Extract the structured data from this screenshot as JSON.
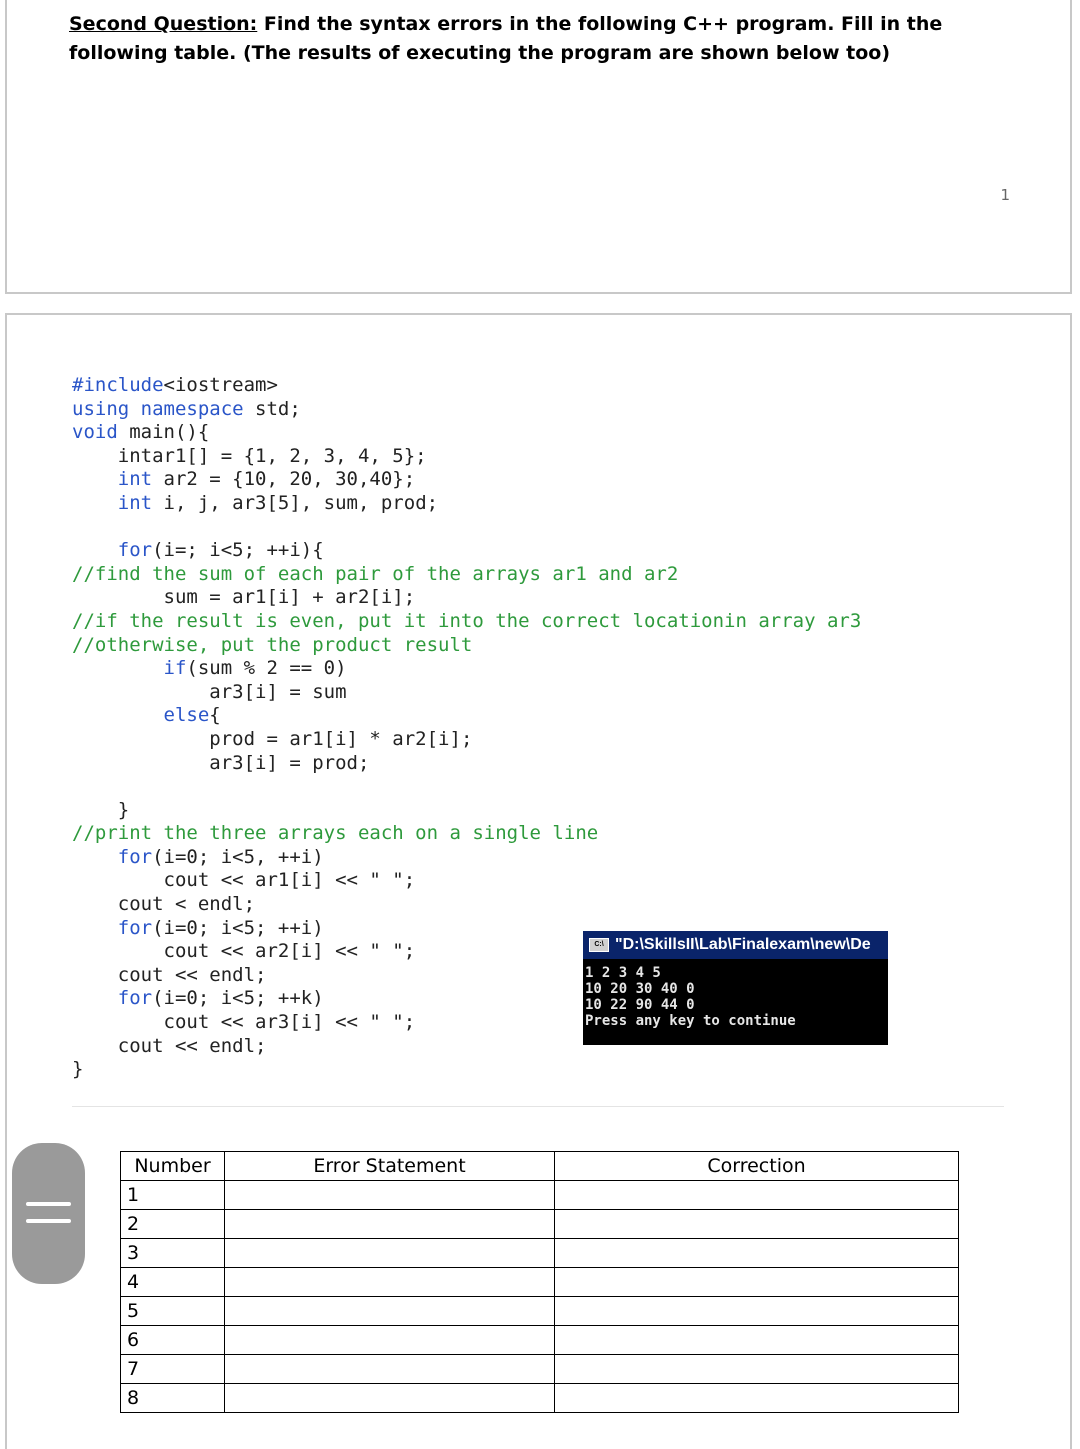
{
  "question": {
    "label": "Second Question:",
    "text": " Find the syntax errors in the following C++ program. Fill in the following table. (The results of executing the program are shown below too)"
  },
  "page_number": "1",
  "code_lines": [
    {
      "indent": "",
      "parts": [
        {
          "t": "#include",
          "c": "kw"
        },
        {
          "t": "<iostream>",
          "c": ""
        }
      ]
    },
    {
      "indent": "",
      "parts": [
        {
          "t": "using namespace",
          "c": "kw"
        },
        {
          "t": " std;",
          "c": ""
        }
      ]
    },
    {
      "indent": "",
      "parts": [
        {
          "t": "void",
          "c": "kw"
        },
        {
          "t": " main(){",
          "c": ""
        }
      ]
    },
    {
      "indent": "    ",
      "parts": [
        {
          "t": "intar1[] = {1, 2, 3, 4, 5};",
          "c": ""
        }
      ]
    },
    {
      "indent": "    ",
      "parts": [
        {
          "t": "int",
          "c": "kw"
        },
        {
          "t": " ar2 = {10, 20, 30,40};",
          "c": ""
        }
      ]
    },
    {
      "indent": "    ",
      "parts": [
        {
          "t": "int",
          "c": "kw"
        },
        {
          "t": " i, j, ar3[5], sum, prod;",
          "c": ""
        }
      ]
    },
    {
      "indent": "",
      "parts": []
    },
    {
      "indent": "    ",
      "parts": [
        {
          "t": "for",
          "c": "kw"
        },
        {
          "t": "(i=; i<5; ++i){",
          "c": ""
        }
      ]
    },
    {
      "indent": "",
      "parts": [
        {
          "t": "//find the sum of each pair of the arrays ar1 and ar2",
          "c": "cm"
        }
      ]
    },
    {
      "indent": "        ",
      "parts": [
        {
          "t": "sum = ar1[i] + ar2[i];",
          "c": ""
        }
      ]
    },
    {
      "indent": "",
      "parts": [
        {
          "t": "//if the result is even, put it into the correct locationin array ar3",
          "c": "cm"
        }
      ]
    },
    {
      "indent": "",
      "parts": [
        {
          "t": "//otherwise, put the product result",
          "c": "cm"
        }
      ]
    },
    {
      "indent": "        ",
      "parts": [
        {
          "t": "if",
          "c": "kw"
        },
        {
          "t": "(sum % 2 == 0)",
          "c": ""
        }
      ]
    },
    {
      "indent": "            ",
      "parts": [
        {
          "t": "ar3[i] = sum",
          "c": ""
        }
      ]
    },
    {
      "indent": "        ",
      "parts": [
        {
          "t": "else",
          "c": "kw"
        },
        {
          "t": "{",
          "c": ""
        }
      ]
    },
    {
      "indent": "            ",
      "parts": [
        {
          "t": "prod = ar1[i] * ar2[i];",
          "c": ""
        }
      ]
    },
    {
      "indent": "            ",
      "parts": [
        {
          "t": "ar3[i] = prod;",
          "c": ""
        }
      ]
    },
    {
      "indent": "",
      "parts": []
    },
    {
      "indent": "    ",
      "parts": [
        {
          "t": "}",
          "c": ""
        }
      ]
    },
    {
      "indent": "",
      "parts": [
        {
          "t": "//print the three arrays each on a single line",
          "c": "cm"
        }
      ]
    },
    {
      "indent": "    ",
      "parts": [
        {
          "t": "for",
          "c": "kw"
        },
        {
          "t": "(i=0; i<5, ++i)",
          "c": ""
        }
      ]
    },
    {
      "indent": "        ",
      "parts": [
        {
          "t": "cout << ar1[i] << \" \";",
          "c": ""
        }
      ]
    },
    {
      "indent": "    ",
      "parts": [
        {
          "t": "cout < endl;",
          "c": ""
        }
      ]
    },
    {
      "indent": "    ",
      "parts": [
        {
          "t": "for",
          "c": "kw"
        },
        {
          "t": "(i=0; i<5; ++i)",
          "c": ""
        }
      ]
    },
    {
      "indent": "        ",
      "parts": [
        {
          "t": "cout << ar2[i] << \" \";",
          "c": ""
        }
      ]
    },
    {
      "indent": "    ",
      "parts": [
        {
          "t": "cout << endl;",
          "c": ""
        }
      ]
    },
    {
      "indent": "    ",
      "parts": [
        {
          "t": "for",
          "c": "kw"
        },
        {
          "t": "(i=0; i<5; ++k)",
          "c": ""
        }
      ]
    },
    {
      "indent": "        ",
      "parts": [
        {
          "t": "cout << ar3[i] << \" \";",
          "c": ""
        }
      ]
    },
    {
      "indent": "    ",
      "parts": [
        {
          "t": "cout << endl;",
          "c": ""
        }
      ]
    },
    {
      "indent": "",
      "parts": [
        {
          "t": "}",
          "c": ""
        }
      ]
    }
  ],
  "console": {
    "title": "\"D:\\SkillsII\\Lab\\Finalexam\\new\\De",
    "lines": [
      "1 2 3 4 5",
      "10 20 30 40 0",
      "10 22 90 44 0",
      "Press any key to continue"
    ]
  },
  "table": {
    "headers": [
      "Number",
      "Error Statement",
      "Correction"
    ],
    "rows": [
      {
        "num": "1",
        "error": "",
        "correction": ""
      },
      {
        "num": "2",
        "error": "",
        "correction": ""
      },
      {
        "num": "3",
        "error": "",
        "correction": ""
      },
      {
        "num": "4",
        "error": "",
        "correction": ""
      },
      {
        "num": "5",
        "error": "",
        "correction": ""
      },
      {
        "num": "6",
        "error": "",
        "correction": ""
      },
      {
        "num": "7",
        "error": "",
        "correction": ""
      },
      {
        "num": "8",
        "error": "",
        "correction": ""
      }
    ]
  }
}
